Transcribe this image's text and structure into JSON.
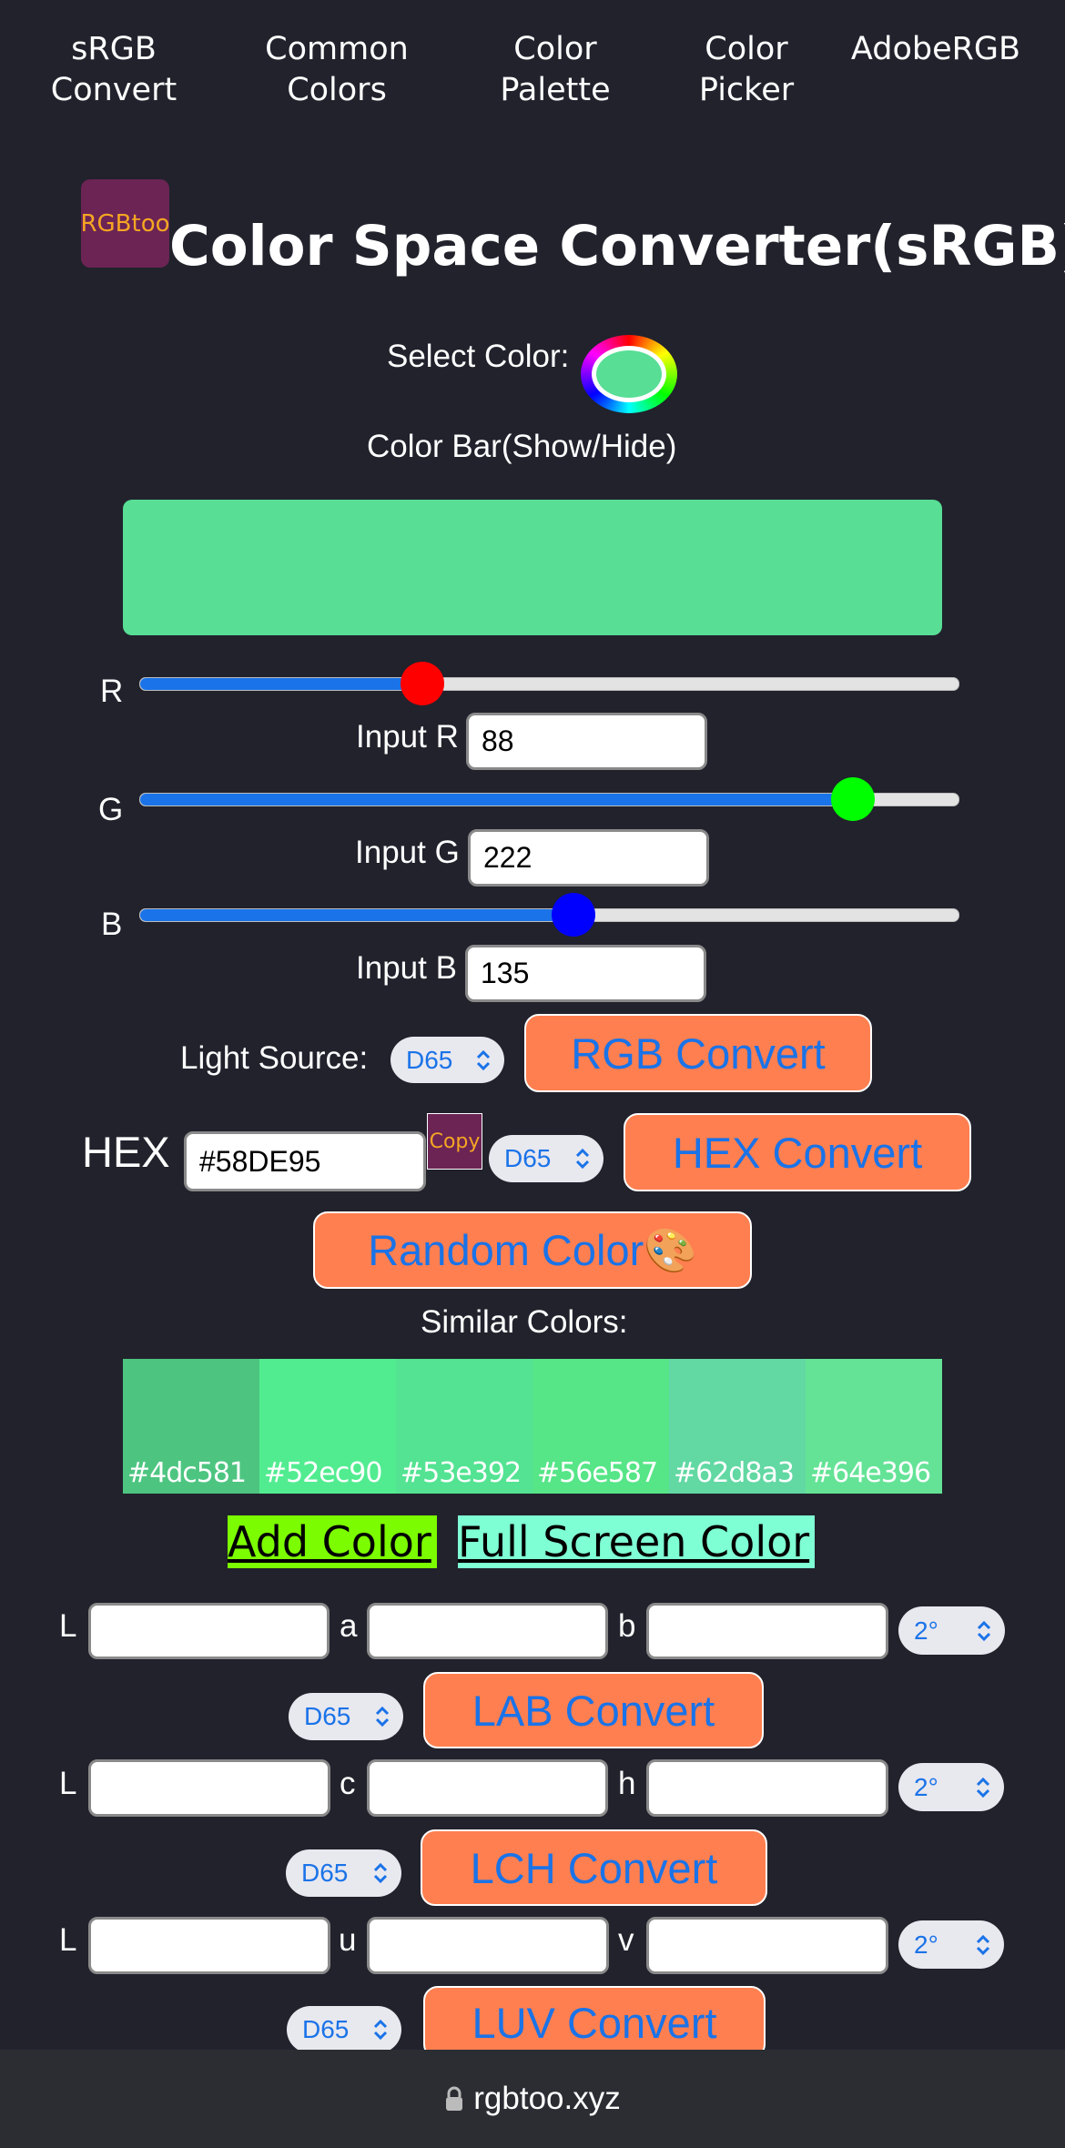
{
  "nav": [
    {
      "label": "sRGB\nConvert"
    },
    {
      "label": "Common\nColors"
    },
    {
      "label": "Color\nPalette"
    },
    {
      "label": "Color\nPicker"
    },
    {
      "label": "AdobeRGB"
    }
  ],
  "logo_text": "RGBtoo",
  "title": "Color Space Converter(sRGB)",
  "select_color_label": "Select Color:",
  "color_bar_toggle": "Color Bar(Show/Hide)",
  "current_color": "#58DE95",
  "sliders": [
    {
      "channel": "R",
      "input_label": "Input R",
      "value": "88",
      "level": 0.345,
      "thumb_color": "#ff0000"
    },
    {
      "channel": "G",
      "input_label": "Input G",
      "value": "222",
      "level": 0.871,
      "thumb_color": "#00ff00"
    },
    {
      "channel": "B",
      "input_label": "Input B",
      "value": "135",
      "level": 0.529,
      "thumb_color": "#0000ff"
    }
  ],
  "light_source_label": "Light Source:",
  "light_source_value": "D65",
  "rgb_convert_label": "RGB Convert",
  "hex_label": "HEX",
  "hex_value": "#58DE95",
  "copy_label": "Copy",
  "hex_illuminant": "D65",
  "hex_convert_label": "HEX Convert",
  "random_color_label": "Random Color🎨",
  "similar_colors_label": "Similar Colors:",
  "similar_colors": [
    {
      "hex": "#4dc581"
    },
    {
      "hex": "#52ec90"
    },
    {
      "hex": "#53e392"
    },
    {
      "hex": "#56e587"
    },
    {
      "hex": "#62d8a3"
    },
    {
      "hex": "#64e396"
    }
  ],
  "add_color_label": "Add Color",
  "full_screen_label": "Full Screen Color",
  "lab": {
    "l_label": "L",
    "a_label": "a",
    "b_label": "b",
    "observer": "2°",
    "illuminant": "D65",
    "convert_label": "LAB Convert"
  },
  "lch": {
    "l_label": "L",
    "c_label": "c",
    "h_label": "h",
    "observer": "2°",
    "illuminant": "D65",
    "convert_label": "LCH Convert"
  },
  "luv": {
    "l_label": "L",
    "u_label": "u",
    "v_label": "v",
    "observer": "2°",
    "illuminant": "D65",
    "convert_label": "LUV Convert"
  },
  "footer_url": "rgbtoo.xyz",
  "colors": {
    "background": "#21222c",
    "button": "#ff7f50",
    "button_text": "#1a73e8",
    "logo_bg": "#6b2454",
    "add_color_bg": "#7cfc00",
    "full_screen_bg": "#7fffd4"
  }
}
